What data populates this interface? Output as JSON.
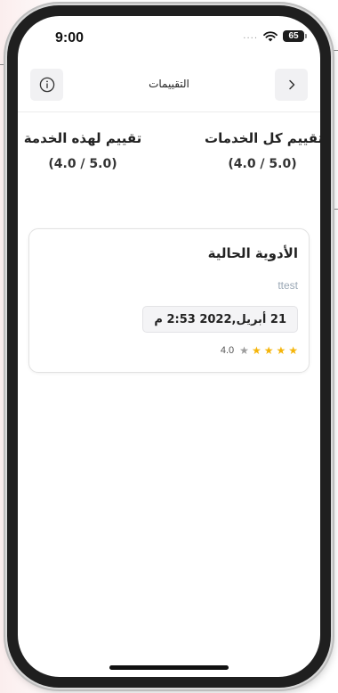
{
  "status_bar": {
    "time": "9:00",
    "signal_dots": "....",
    "battery": "65"
  },
  "nav": {
    "title": "التقييمات",
    "back_icon": "chevron-right-icon",
    "info_icon": "info-icon"
  },
  "ratings": {
    "all_services_label": "تقييم كل الخدمات",
    "all_services_score": "(4.0 / 5.0)",
    "this_service_label": "تقييم لهذه الخدمة",
    "this_service_score": "(4.0 / 5.0)"
  },
  "review": {
    "title": "الأدوية الحالية",
    "subtitle": "ttest",
    "date": "21 أبريل,2022 2:53 م",
    "rating_value": "4.0",
    "stars_filled": 4,
    "stars_total": 5
  },
  "colors": {
    "star_on": "#f5b50a",
    "star_off": "#9e9e9e",
    "subtitle": "#9aa7b5"
  }
}
